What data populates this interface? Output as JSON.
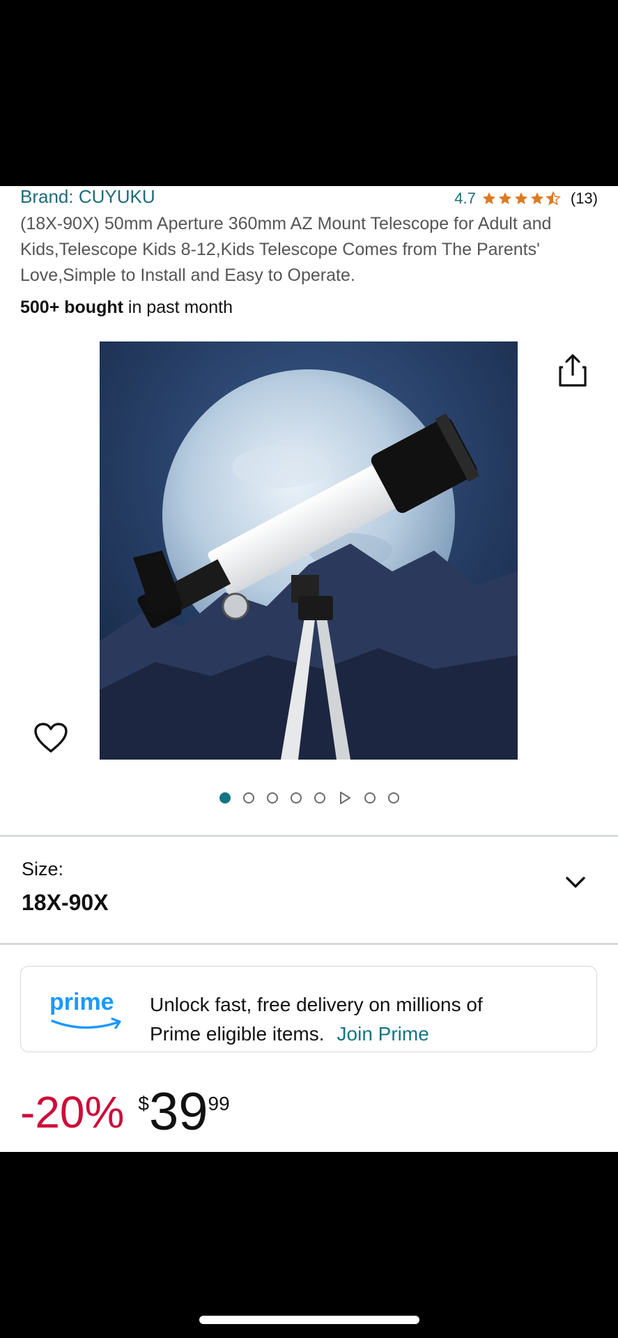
{
  "product": {
    "brand": "Brand: CUYUKU",
    "rating": "4.7",
    "rating_count": "(13)",
    "stars": 4.5,
    "title": "(18X-90X) 50mm Aperture 360mm AZ Mount Telescope for Adult and Kids,Telescope Kids 8-12,Kids Telescope Comes from The Parents' Love,Simple to Install and Easy to Operate.",
    "bought_bold": "500+ bought",
    "bought_rest": " in past month"
  },
  "gallery": {
    "image_alt": "Telescope on tripod in front of a full moon",
    "total_items": 8,
    "active_index": 0,
    "video_index": 5
  },
  "size": {
    "label": "Size:",
    "value": "18X-90X"
  },
  "prime": {
    "logo_text": "prime",
    "message_line1": "Unlock fast, free delivery on millions of",
    "message_line2": "Prime eligible items.",
    "link": "Join Prime"
  },
  "price": {
    "discount": "-20%",
    "currency": "$",
    "whole": "39",
    "fraction": "99"
  },
  "colors": {
    "link": "#127584",
    "discount": "#cc0c39",
    "star": "#de7921",
    "prime_blue": "#1a98ff"
  }
}
